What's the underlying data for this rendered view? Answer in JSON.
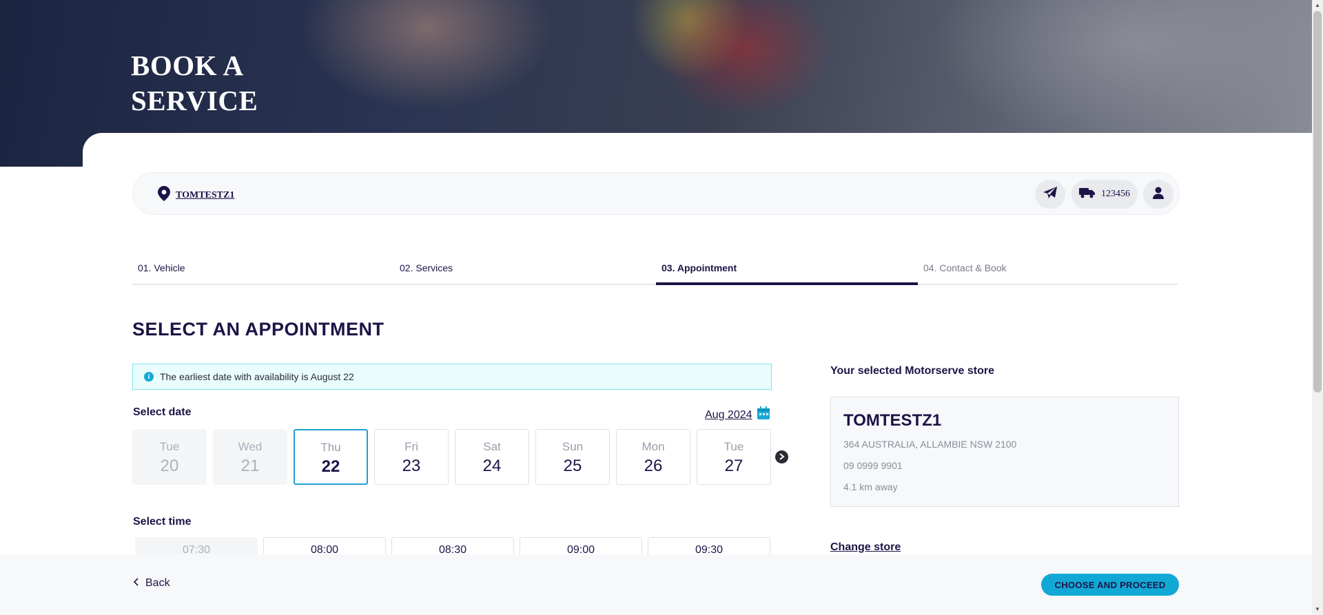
{
  "hero": {
    "title": "BOOK A SERVICE"
  },
  "topbar": {
    "store_name": "TOMTESTZ1",
    "vehicle_rego": "123456"
  },
  "steps": [
    {
      "label": "01. Vehicle",
      "state": "done"
    },
    {
      "label": "02. Services",
      "state": "done"
    },
    {
      "label": "03. Appointment",
      "state": "active"
    },
    {
      "label": "04. Contact & Book",
      "state": "future"
    }
  ],
  "main": {
    "title": "SELECT AN APPOINTMENT",
    "info_banner": "The earliest date with availability is August 22",
    "select_date_label": "Select date",
    "month_label": "Aug 2024",
    "dates": [
      {
        "day": "Tue",
        "num": "20",
        "state": "disabled"
      },
      {
        "day": "Wed",
        "num": "21",
        "state": "disabled"
      },
      {
        "day": "Thu",
        "num": "22",
        "state": "selected"
      },
      {
        "day": "Fri",
        "num": "23",
        "state": "available"
      },
      {
        "day": "Sat",
        "num": "24",
        "state": "available"
      },
      {
        "day": "Sun",
        "num": "25",
        "state": "available"
      },
      {
        "day": "Mon",
        "num": "26",
        "state": "available"
      },
      {
        "day": "Tue",
        "num": "27",
        "state": "available"
      }
    ],
    "select_time_label": "Select time",
    "times": [
      {
        "label": "07:30",
        "state": "disabled"
      },
      {
        "label": "08:00",
        "state": "available"
      },
      {
        "label": "08:30",
        "state": "available"
      },
      {
        "label": "09:00",
        "state": "available"
      },
      {
        "label": "09:30",
        "state": "available"
      }
    ]
  },
  "store": {
    "heading": "Your selected Motorserve store",
    "name": "TOMTESTZ1",
    "address": "364 AUSTRALIA, ALLAMBIE NSW 2100",
    "phone": "09 0999 9901",
    "distance": "4.1 km away",
    "change_label": "Change store"
  },
  "footer": {
    "back_label": "Back",
    "proceed_label": "CHOOSE AND PROCEED"
  },
  "colors": {
    "brand_navy": "#1c1446",
    "accent_cyan": "#12a8d6",
    "info_bg": "#e9fdfd"
  }
}
